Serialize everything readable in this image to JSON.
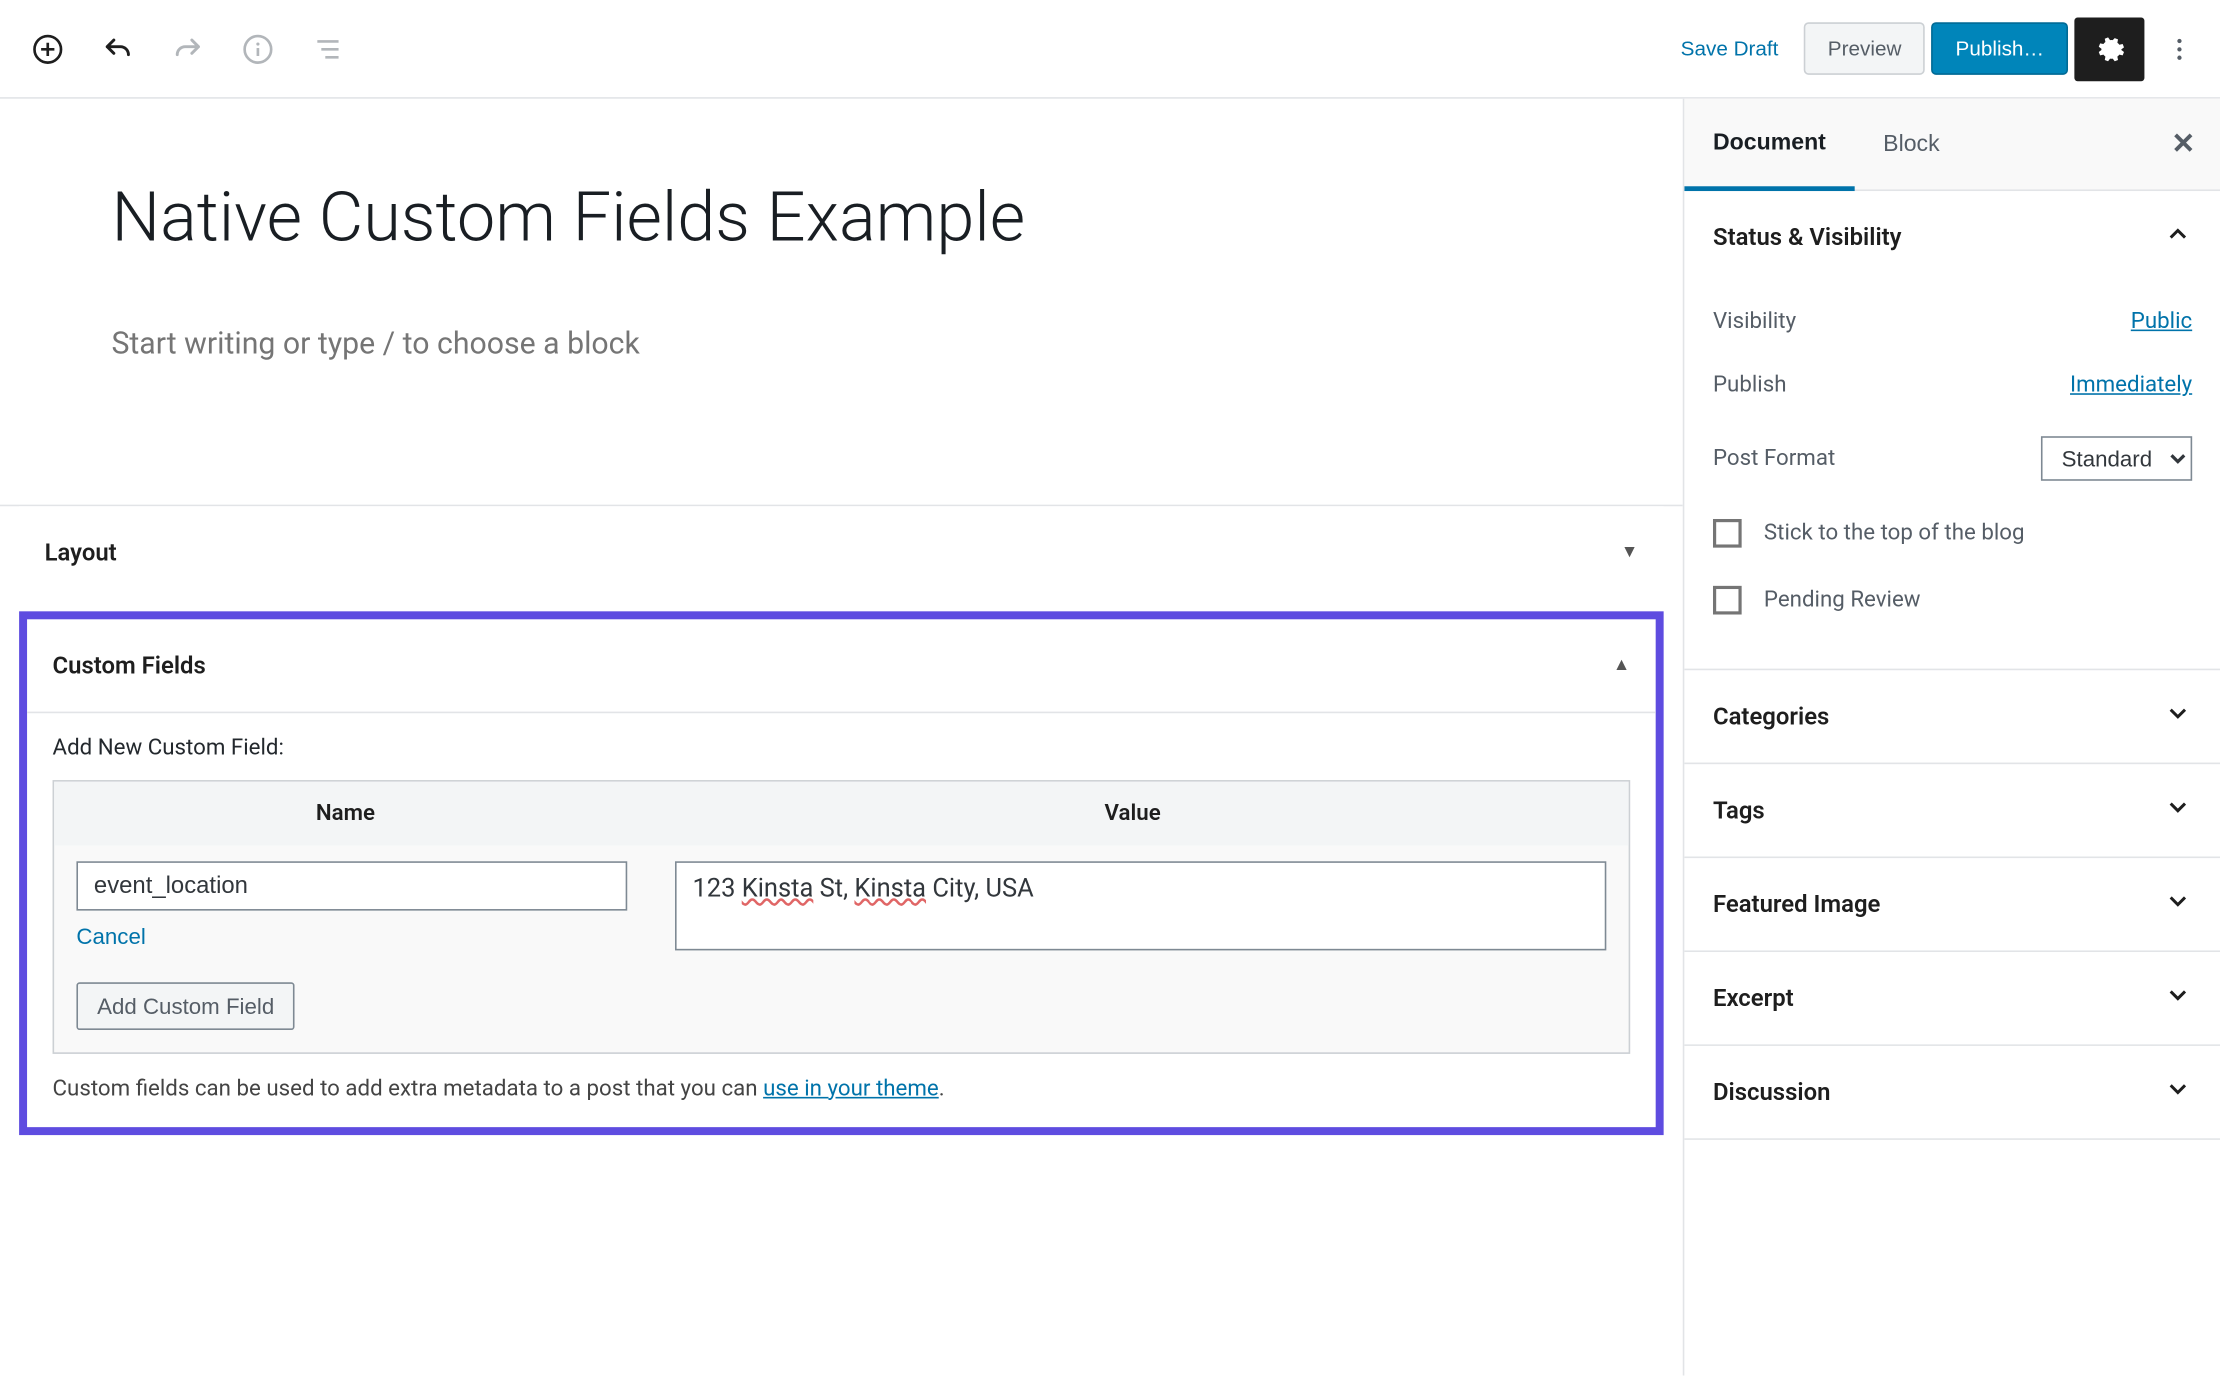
{
  "toolbar": {
    "save_draft": "Save Draft",
    "preview": "Preview",
    "publish": "Publish…"
  },
  "post": {
    "title": "Native Custom Fields Example",
    "body_placeholder": "Start writing or type / to choose a block"
  },
  "metaboxes": {
    "layout": {
      "title": "Layout"
    },
    "custom_fields": {
      "title": "Custom Fields",
      "add_new_label": "Add New Custom Field:",
      "th_name": "Name",
      "th_value": "Value",
      "name_value": "event_location",
      "value_value": "123 Kinsta St, Kinsta City, USA",
      "cancel": "Cancel",
      "add_button": "Add Custom Field",
      "help_prefix": "Custom fields can be used to add extra metadata to a post that you can ",
      "help_link": "use in your theme",
      "help_suffix": "."
    }
  },
  "sidebar": {
    "tabs": {
      "document": "Document",
      "block": "Block"
    },
    "status": {
      "title": "Status & Visibility",
      "visibility_label": "Visibility",
      "visibility_value": "Public",
      "publish_label": "Publish",
      "publish_value": "Immediately",
      "post_format_label": "Post Format",
      "post_format_value": "Standard",
      "stick_label": "Stick to the top of the blog",
      "pending_label": "Pending Review"
    },
    "panels": {
      "categories": "Categories",
      "tags": "Tags",
      "featured": "Featured Image",
      "excerpt": "Excerpt",
      "discussion": "Discussion"
    }
  }
}
